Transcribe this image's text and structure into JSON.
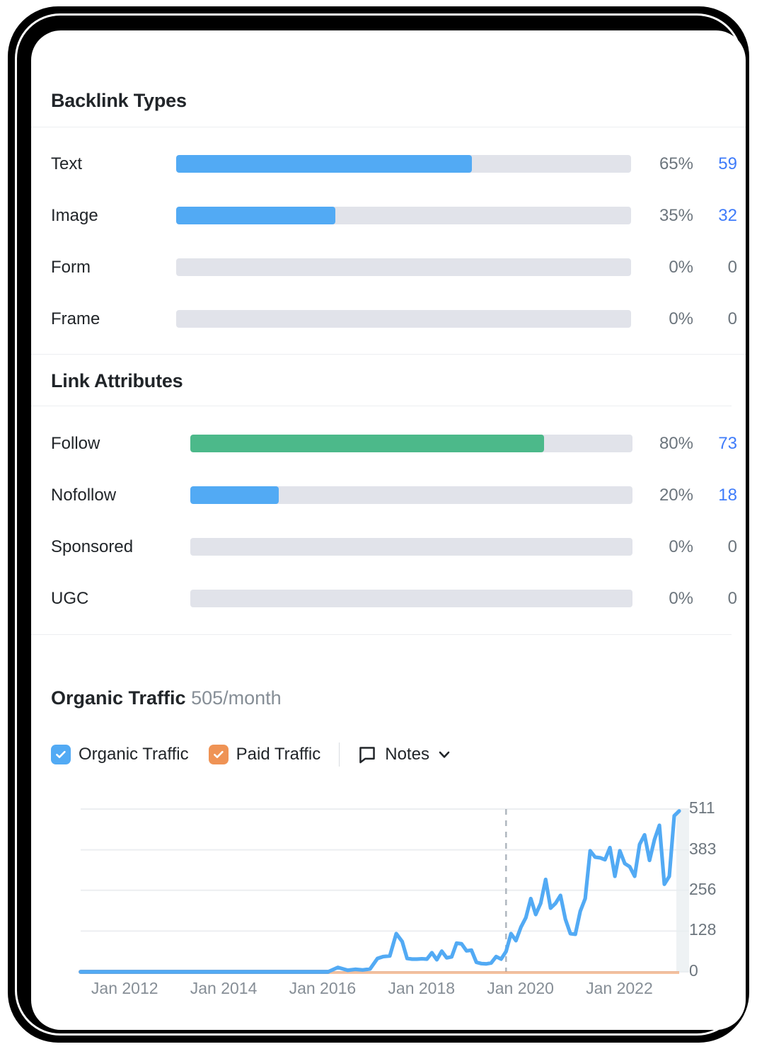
{
  "backlink_types": {
    "title": "Backlink Types",
    "rows": [
      {
        "label": "Text",
        "pct": "65%",
        "pct_value": 65,
        "count": "59",
        "color": "#52aaf4",
        "has_link": true
      },
      {
        "label": "Image",
        "pct": "35%",
        "pct_value": 35,
        "count": "32",
        "color": "#52aaf4",
        "has_link": true
      },
      {
        "label": "Form",
        "pct": "0%",
        "pct_value": 0,
        "count": "0",
        "color": "#52aaf4",
        "has_link": false
      },
      {
        "label": "Frame",
        "pct": "0%",
        "pct_value": 0,
        "count": "0",
        "color": "#52aaf4",
        "has_link": false
      }
    ]
  },
  "link_attributes": {
    "title": "Link Attributes",
    "rows": [
      {
        "label": "Follow",
        "pct": "80%",
        "pct_value": 80,
        "count": "73",
        "color": "#4cb98a",
        "has_link": true
      },
      {
        "label": "Nofollow",
        "pct": "20%",
        "pct_value": 20,
        "count": "18",
        "color": "#52aaf4",
        "has_link": true
      },
      {
        "label": "Sponsored",
        "pct": "0%",
        "pct_value": 0,
        "count": "0",
        "color": "#52aaf4",
        "has_link": false
      },
      {
        "label": "UGC",
        "pct": "0%",
        "pct_value": 0,
        "count": "0",
        "color": "#52aaf4",
        "has_link": false
      }
    ]
  },
  "organic_traffic": {
    "title": "Organic Traffic",
    "subtitle": "505/month",
    "legend": [
      {
        "label": "Organic Traffic",
        "color": "#52aaf4",
        "checked": true
      },
      {
        "label": "Paid Traffic",
        "color": "#ef9355",
        "checked": true
      }
    ],
    "notes_label": "Notes"
  },
  "colors": {
    "blue": "#52aaf4",
    "green": "#4cb98a",
    "orange": "#ef9355",
    "track": "#e1e3ea",
    "count_link": "#3e7bfa",
    "muted": "#6c757d"
  },
  "chart_data": {
    "type": "line",
    "title": "Organic Traffic",
    "xlabel": "",
    "ylabel": "",
    "grid": true,
    "legend_position": "top-left",
    "ylim": [
      0,
      511
    ],
    "yticks": [
      "0",
      "128",
      "256",
      "383",
      "511"
    ],
    "ytick_values": [
      0,
      128,
      256,
      383,
      511
    ],
    "xticks": [
      "Jan 2012",
      "Jan 2014",
      "Jan 2016",
      "Jan 2018",
      "Jan 2020",
      "Jan 2022"
    ],
    "xtick_values": [
      2012,
      2014,
      2016,
      2018,
      2020,
      2022
    ],
    "xlim": [
      2011.0,
      2023.3
    ],
    "annotation_line_x": 2019.6,
    "series": [
      {
        "name": "Organic Traffic",
        "color": "#52aaf4",
        "x": [
          2011.0,
          2011.5,
          2012.0,
          2012.5,
          2013.0,
          2013.5,
          2014.0,
          2014.5,
          2015.0,
          2015.5,
          2016.0,
          2016.2,
          2016.4,
          2016.55,
          2016.7,
          2016.85,
          2017.0,
          2017.12,
          2017.25,
          2017.38,
          2017.5,
          2017.6,
          2017.7,
          2017.8,
          2017.9,
          2018.0,
          2018.1,
          2018.2,
          2018.3,
          2018.4,
          2018.5,
          2018.6,
          2018.7,
          2018.8,
          2018.9,
          2019.0,
          2019.1,
          2019.2,
          2019.3,
          2019.4,
          2019.5,
          2019.6,
          2019.7,
          2019.8,
          2019.9,
          2020.0,
          2020.1,
          2020.2,
          2020.3,
          2020.4,
          2020.5,
          2020.6,
          2020.7,
          2020.8,
          2020.9,
          2021.0,
          2021.1,
          2021.2,
          2021.3,
          2021.4,
          2021.5,
          2021.6,
          2021.7,
          2021.8,
          2021.9,
          2022.0,
          2022.1,
          2022.2,
          2022.3,
          2022.4,
          2022.5,
          2022.6,
          2022.7,
          2022.8,
          2022.9,
          2023.0,
          2023.1
        ],
        "y": [
          0,
          0,
          0,
          0,
          0,
          0,
          0,
          0,
          0,
          0,
          0,
          14,
          5,
          8,
          6,
          9,
          42,
          48,
          50,
          120,
          95,
          42,
          40,
          40,
          41,
          40,
          60,
          38,
          65,
          44,
          47,
          90,
          88,
          66,
          68,
          30,
          26,
          25,
          28,
          48,
          40,
          64,
          120,
          98,
          140,
          170,
          230,
          180,
          215,
          290,
          200,
          215,
          240,
          165,
          120,
          118,
          190,
          230,
          380,
          360,
          358,
          352,
          390,
          300,
          380,
          340,
          330,
          300,
          400,
          430,
          350,
          415,
          460,
          275,
          300,
          490,
          505,
          505
        ]
      },
      {
        "name": "Paid Traffic",
        "color": "#ef9355",
        "x": [
          2011.0,
          2023.1
        ],
        "y": [
          0,
          0
        ]
      }
    ]
  }
}
